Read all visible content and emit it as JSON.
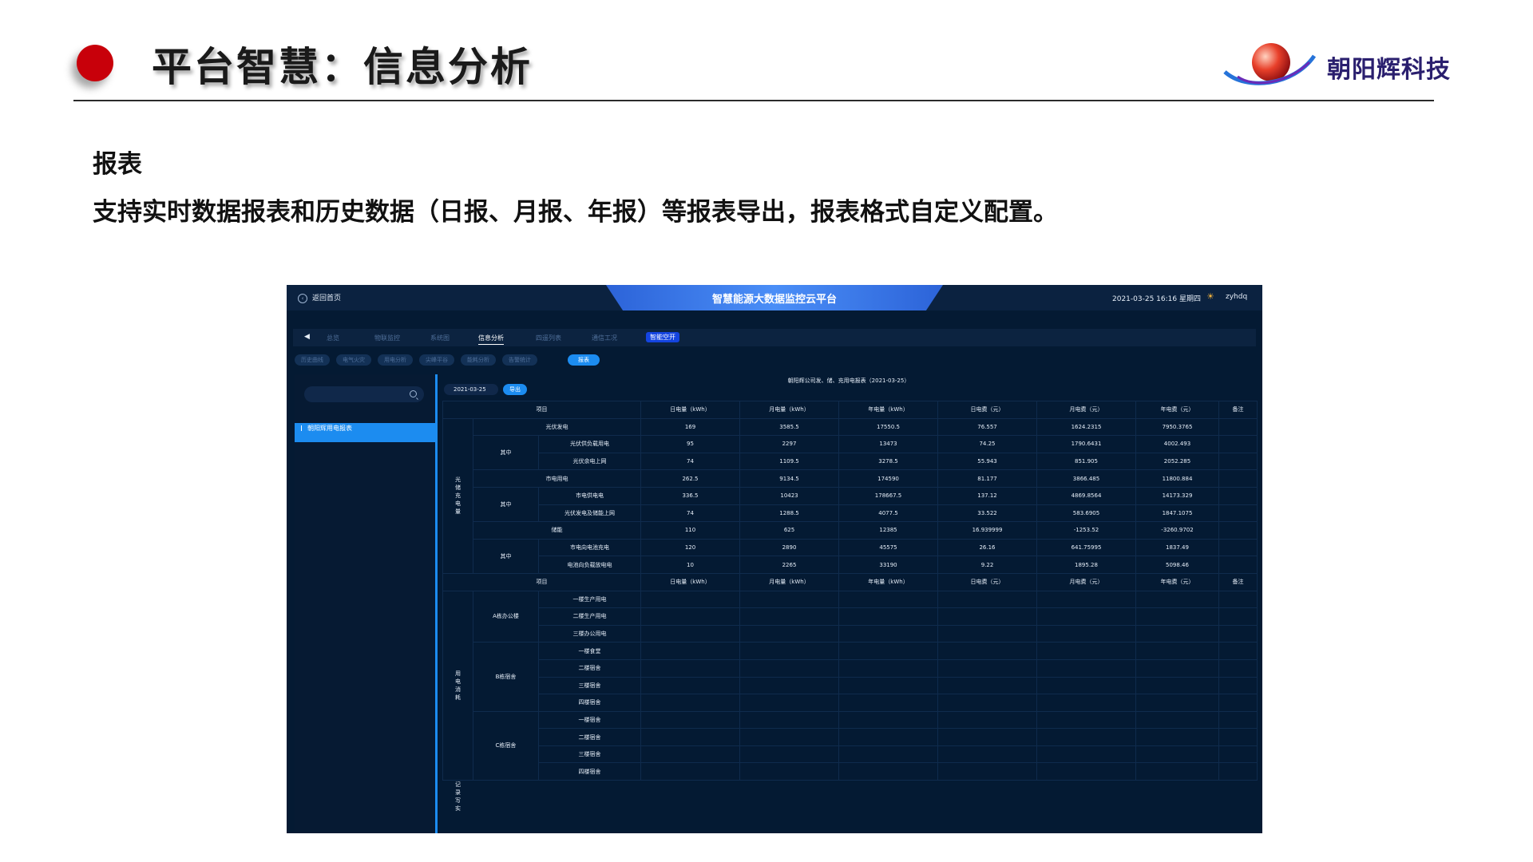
{
  "slide": {
    "title": "平台智慧：信息分析",
    "logo_text": "朝阳辉科技",
    "section_title": "报表",
    "section_desc": "支持实时数据报表和历史数据（日报、月报、年报）等报表导出，报表格式自定义配置。"
  },
  "app": {
    "back_label": "返回首页",
    "platform_title": "智慧能源大数据监控云平台",
    "datetime": "2021-03-25 16:16 星期四",
    "user": "zyhdq",
    "nav_items": [
      "总览",
      "物联监控",
      "系统图",
      "信息分析",
      "四遥列表",
      "通信工况",
      "智能空开"
    ],
    "sub_tabs": [
      "历史曲线",
      "电气火灾",
      "用电分析",
      "尖峰平谷",
      "能耗分析",
      "告警统计",
      "报表"
    ],
    "tree_item": "朝阳辉用电报表",
    "date_value": "2021-03-25",
    "export_label": "导出",
    "report_title": "朝阳辉公司发、储、充用电报表（2021-03-25）",
    "columns": [
      "项目",
      "日电量（kWh）",
      "月电量（kWh）",
      "年电量（kWh）",
      "日电费（元）",
      "月电费（元）",
      "年电费（元）",
      "备注"
    ],
    "section1_label": "光储充电量",
    "section2_label": "用电消耗",
    "last_row_label": "记录写实",
    "sub_label": "其中",
    "s1": {
      "r1_label": "光伏发电",
      "r1": [
        "169",
        "3585.5",
        "17550.5",
        "76.557",
        "1624.2315",
        "7950.3765"
      ],
      "r2_label": "光伏供负载用电",
      "r2": [
        "95",
        "2297",
        "13473",
        "74.25",
        "1790.6431",
        "4002.493"
      ],
      "r3_label": "光伏余电上网",
      "r3": [
        "74",
        "1109.5",
        "3278.5",
        "55.943",
        "851.905",
        "2052.285"
      ],
      "r4_label": "市电用电",
      "r4": [
        "262.5",
        "9134.5",
        "174590",
        "81.177",
        "3866.485",
        "11800.884"
      ],
      "r5_label": "市电供电电",
      "r5": [
        "336.5",
        "10423",
        "178667.5",
        "137.12",
        "4869.8564",
        "14173.329"
      ],
      "r6_label": "光伏发电及储能上网",
      "r6": [
        "74",
        "1288.5",
        "4077.5",
        "33.522",
        "583.6905",
        "1847.1075"
      ],
      "r7_label": "储能",
      "r7": [
        "110",
        "625",
        "12385",
        "16.939999",
        "-1253.52",
        "-3260.9702"
      ],
      "r8_label": "市电向电池充电",
      "r8": [
        "120",
        "2890",
        "45575",
        "26.16",
        "641.75995",
        "1837.49"
      ],
      "r9_label": "电池向负载放电电",
      "r9": [
        "10",
        "2265",
        "33190",
        "9.22",
        "1895.28",
        "5098.46"
      ]
    },
    "s2": {
      "a_label": "A栋办公楼",
      "a_items": [
        "一楼生产用电",
        "二楼生产用电",
        "三楼办公用电"
      ],
      "b_label": "B栋宿舍",
      "b_items": [
        "一楼食堂",
        "二楼宿舍",
        "三楼宿舍",
        "四楼宿舍"
      ],
      "c_label": "C栋宿舍",
      "c_items": [
        "一楼宿舍",
        "二楼宿舍",
        "三楼宿舍",
        "四楼宿舍"
      ]
    }
  }
}
